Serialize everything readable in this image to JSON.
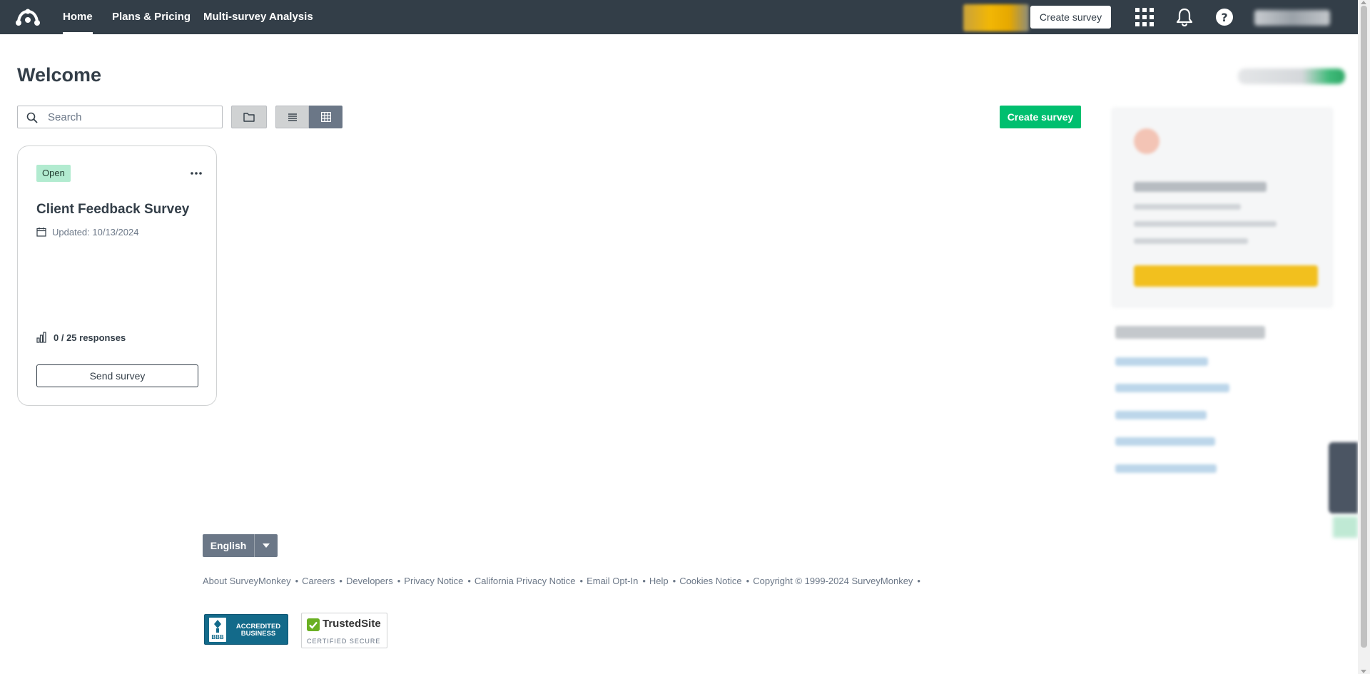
{
  "nav": {
    "items": [
      {
        "label": "Home"
      },
      {
        "label": "Plans & Pricing"
      },
      {
        "label": "Multi-survey Analysis"
      }
    ],
    "create_label": "Create survey",
    "icons": [
      "surveymonkey-logo-icon",
      "apps-grid-icon",
      "bell-icon",
      "help-icon"
    ]
  },
  "main": {
    "title": "Welcome",
    "search_placeholder": "Search",
    "create_label": "Create survey",
    "view_mode": "grid"
  },
  "surveys": [
    {
      "status": "Open",
      "title": "Client Feedback Survey",
      "updated": "Updated: 10/13/2024",
      "responses": "0 / 25 responses",
      "send_label": "Send survey"
    }
  ],
  "footer": {
    "language": "English",
    "links": [
      "About SurveyMonkey",
      "Careers",
      "Developers",
      "Privacy Notice",
      "California Privacy Notice",
      "Email Opt-In",
      "Help",
      "Cookies Notice"
    ],
    "copyright": "Copyright © 1999-2024 SurveyMonkey",
    "bbb_mark": "BBB",
    "bbb_text": "ACCREDITED BUSINESS",
    "trusted_name": "TrustedSite",
    "trusted_sub": "CERTIFIED SECURE"
  },
  "colors": {
    "nav_bg": "#333e48",
    "accent_green": "#00bf6f",
    "badge_bg": "#b2ebd0",
    "view_active": "#6b7787"
  }
}
